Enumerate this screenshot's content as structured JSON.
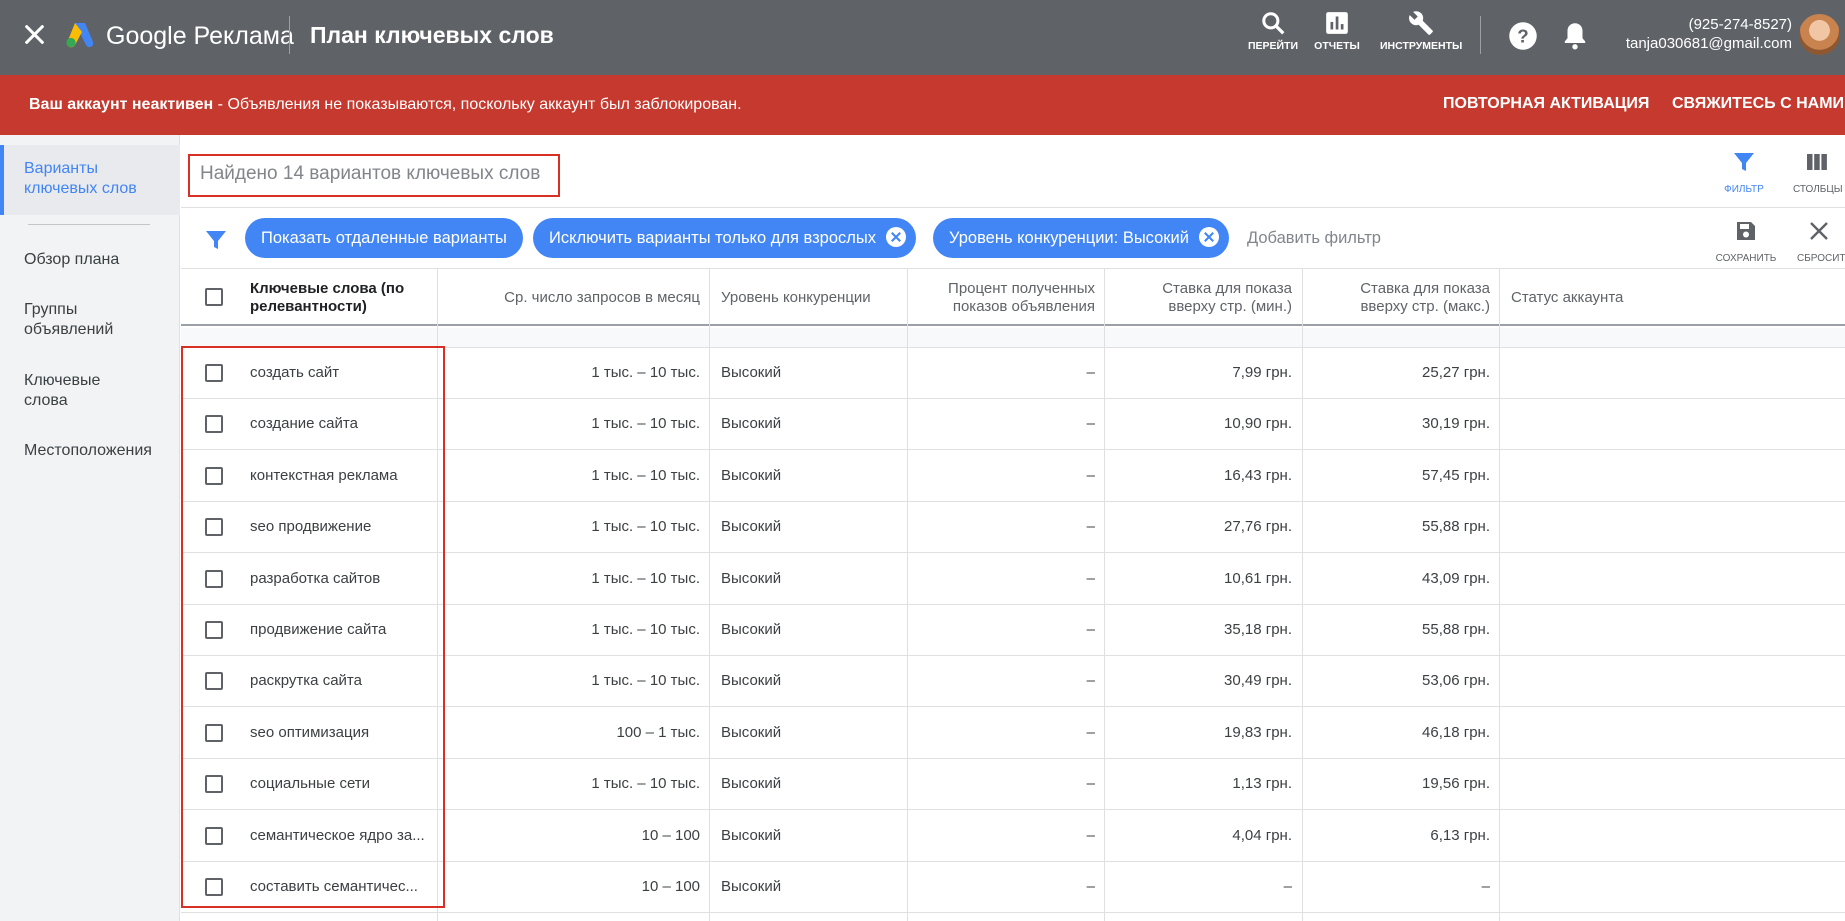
{
  "topbar": {
    "brand": "Google Реклама",
    "page_title": "План ключевых слов",
    "tools": [
      {
        "label": "ПЕРЕЙТИ",
        "icon": "search-icon"
      },
      {
        "label": "ОТЧЕТЫ",
        "icon": "reports-icon"
      },
      {
        "label": "ИНСТРУМЕНТЫ",
        "icon": "wrench-icon"
      }
    ],
    "phone": "(925-274-8527)",
    "email": "tanja030681@gmail.com"
  },
  "alert": {
    "bold": "Ваш аккаунт неактивен",
    "text": " - Объявления не показываются, поскольку аккаунт был заблокирован.",
    "reactivate": "ПОВТОРНАЯ АКТИВАЦИЯ",
    "contact": "СВЯЖИТЕСЬ С НАМИ",
    "color": "#c5392e"
  },
  "sidebar": {
    "active": "Варианты ключевых слов",
    "items": [
      "Обзор плана",
      "Группы объявлений",
      "Ключевые слова",
      "Местоположения"
    ]
  },
  "main": {
    "found": "Найдено 14 вариантов ключевых слов",
    "filter_label": "ФИЛЬТР",
    "columns_label": "СТОЛБЦЫ",
    "save_label": "СОХРАНИТЬ",
    "reset_label": "СБРОСИТЬ",
    "chips": [
      "Показать отдаленные варианты",
      "Исключить варианты только для взрослых",
      "Уровень конкуренции: Высокий"
    ],
    "add_filter": "Добавить фильтр"
  },
  "table": {
    "headers": {
      "keyword": "Ключевые слова (по релевантности)",
      "searches": "Ср. число запросов в месяц",
      "competition": "Уровень конкуренции",
      "impr_share": "Процент полученных показов объявления",
      "bid_low": "Ставка для показа вверху стр. (мин.)",
      "bid_high": "Ставка для показа вверху стр. (макс.)",
      "status": "Статус аккаунта"
    },
    "rows": [
      {
        "keyword": "создать сайт",
        "searches": "1 тыс. – 10 тыс.",
        "competition": "Высокий",
        "impr": "–",
        "low": "7,99 грн.",
        "high": "25,27 грн."
      },
      {
        "keyword": "создание сайта",
        "searches": "1 тыс. – 10 тыс.",
        "competition": "Высокий",
        "impr": "–",
        "low": "10,90 грн.",
        "high": "30,19 грн."
      },
      {
        "keyword": "контекстная реклама",
        "searches": "1 тыс. – 10 тыс.",
        "competition": "Высокий",
        "impr": "–",
        "low": "16,43 грн.",
        "high": "57,45 грн."
      },
      {
        "keyword": "seo продвижение",
        "searches": "1 тыс. – 10 тыс.",
        "competition": "Высокий",
        "impr": "–",
        "low": "27,76 грн.",
        "high": "55,88 грн."
      },
      {
        "keyword": "разработка сайтов",
        "searches": "1 тыс. – 10 тыс.",
        "competition": "Высокий",
        "impr": "–",
        "low": "10,61 грн.",
        "high": "43,09 грн."
      },
      {
        "keyword": "продвижение сайта",
        "searches": "1 тыс. – 10 тыс.",
        "competition": "Высокий",
        "impr": "–",
        "low": "35,18 грн.",
        "high": "55,88 грн."
      },
      {
        "keyword": "раскрутка сайта",
        "searches": "1 тыс. – 10 тыс.",
        "competition": "Высокий",
        "impr": "–",
        "low": "30,49 грн.",
        "high": "53,06 грн."
      },
      {
        "keyword": "seo оптимизация",
        "searches": "100 – 1 тыс.",
        "competition": "Высокий",
        "impr": "–",
        "low": "19,83 грн.",
        "high": "46,18 грн."
      },
      {
        "keyword": "социальные сети",
        "searches": "1 тыс. – 10 тыс.",
        "competition": "Высокий",
        "impr": "–",
        "low": "1,13 грн.",
        "high": "19,56 грн."
      },
      {
        "keyword": "семантическое ядро за...",
        "searches": "10 – 100",
        "competition": "Высокий",
        "impr": "–",
        "low": "4,04 грн.",
        "high": "6,13 грн."
      },
      {
        "keyword": "составить семантичес...",
        "searches": "10 – 100",
        "competition": "Высокий",
        "impr": "–",
        "low": "–",
        "high": "–"
      }
    ]
  },
  "colors": {
    "accent": "#4285f4",
    "topbar": "#5f6368",
    "highlight": "#d93025"
  }
}
